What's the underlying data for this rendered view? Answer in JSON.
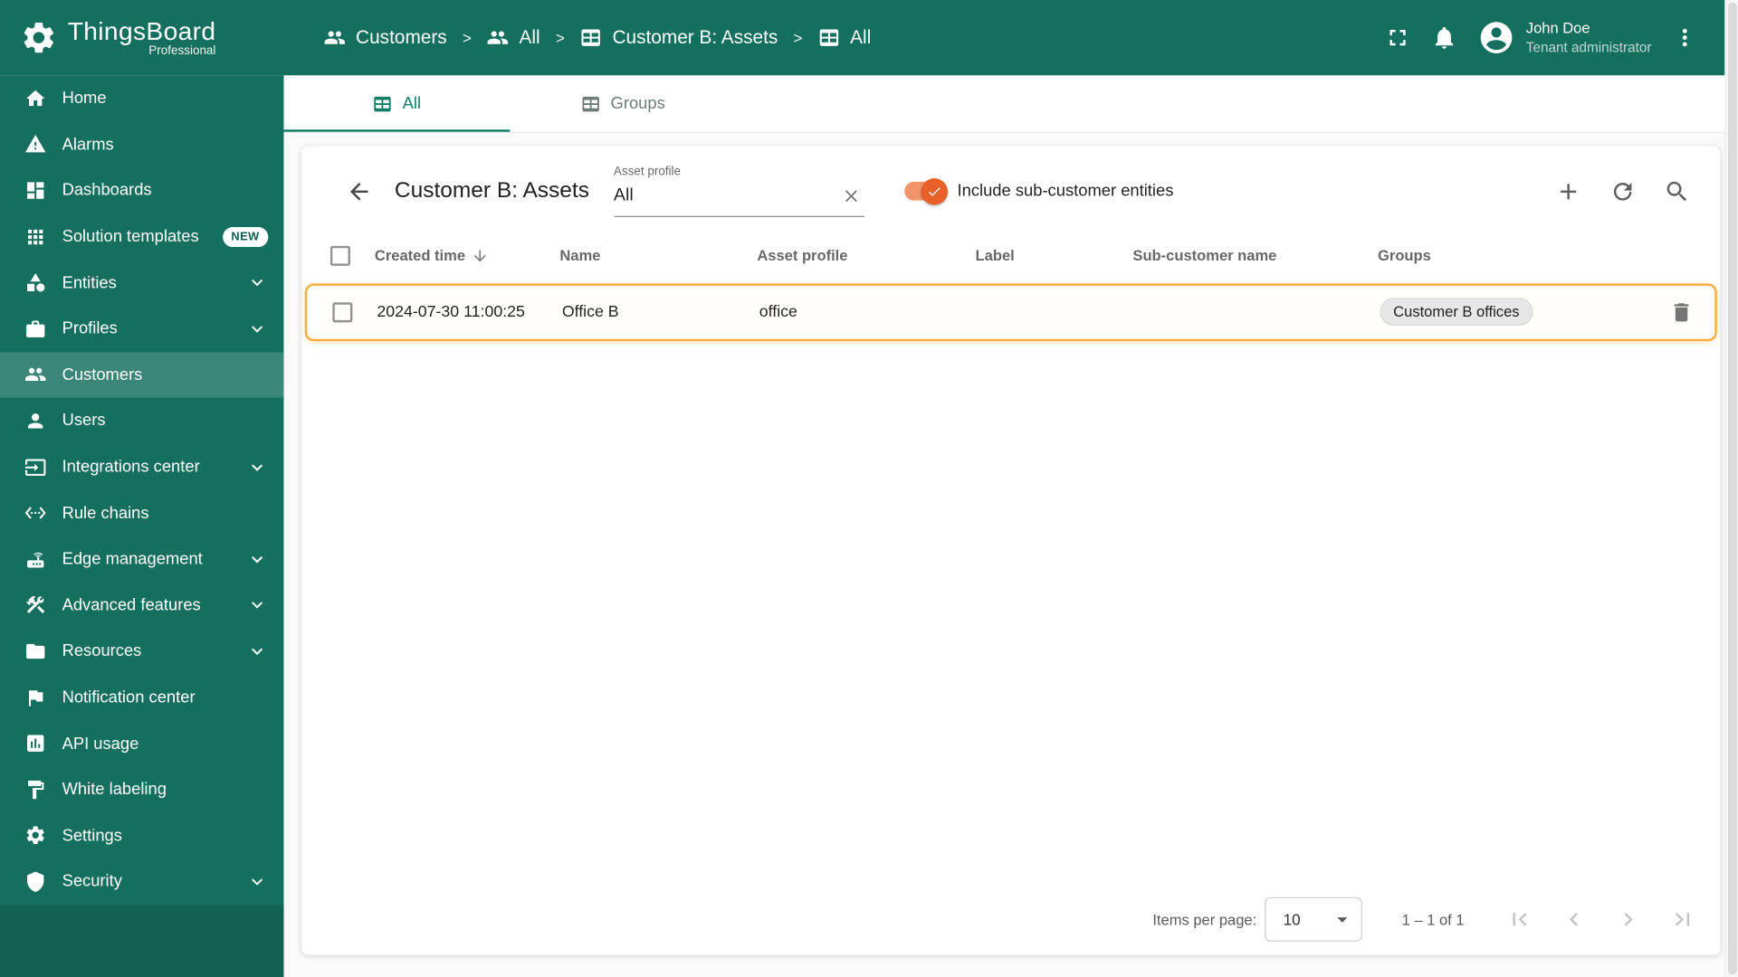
{
  "header": {
    "logo": {
      "title": "ThingsBoard",
      "subtitle": "Professional"
    },
    "breadcrumb": {
      "separator": ">",
      "items": [
        {
          "label": "Customers"
        },
        {
          "label": "All"
        },
        {
          "label": "Customer B: Assets"
        },
        {
          "label": "All"
        }
      ]
    },
    "user": {
      "name": "John Doe",
      "role": "Tenant administrator"
    }
  },
  "sidebar": {
    "items": [
      {
        "label": "Home"
      },
      {
        "label": "Alarms"
      },
      {
        "label": "Dashboards"
      },
      {
        "label": "Solution templates",
        "badge": "NEW"
      },
      {
        "label": "Entities",
        "expandable": true
      },
      {
        "label": "Profiles",
        "expandable": true
      },
      {
        "label": "Customers",
        "active": true
      },
      {
        "label": "Users"
      },
      {
        "label": "Integrations center",
        "expandable": true
      },
      {
        "label": "Rule chains"
      },
      {
        "label": "Edge management",
        "expandable": true
      },
      {
        "label": "Advanced features",
        "expandable": true
      },
      {
        "label": "Resources",
        "expandable": true
      },
      {
        "label": "Notification center"
      },
      {
        "label": "API usage"
      },
      {
        "label": "White labeling"
      },
      {
        "label": "Settings"
      },
      {
        "label": "Security",
        "expandable": true
      }
    ]
  },
  "tabs": [
    {
      "label": "All",
      "active": true
    },
    {
      "label": "Groups",
      "active": false
    }
  ],
  "toolbar": {
    "title": "Customer B: Assets",
    "filter": {
      "label": "Asset profile",
      "value": "All"
    },
    "toggle": {
      "label": "Include sub-customer entities",
      "on": true
    }
  },
  "table": {
    "columns": [
      "Created time",
      "Name",
      "Asset profile",
      "Label",
      "Sub-customer name",
      "Groups"
    ],
    "sort": {
      "column": "Created time",
      "direction": "desc"
    },
    "rows": [
      {
        "created_time": "2024-07-30 11:00:25",
        "name": "Office B",
        "asset_profile": "office",
        "label": "",
        "sub_customer_name": "",
        "group_chip": "Customer B offices"
      }
    ]
  },
  "pagination": {
    "items_per_page_label": "Items per page:",
    "items_per_page": "10",
    "range": "1 – 1 of 1"
  },
  "colors": {
    "primary_green": "#156F5F",
    "tab_active": "#0F7E68",
    "toggle_orange": "#E85F27",
    "row_highlight_border": "#FBAE3F"
  }
}
